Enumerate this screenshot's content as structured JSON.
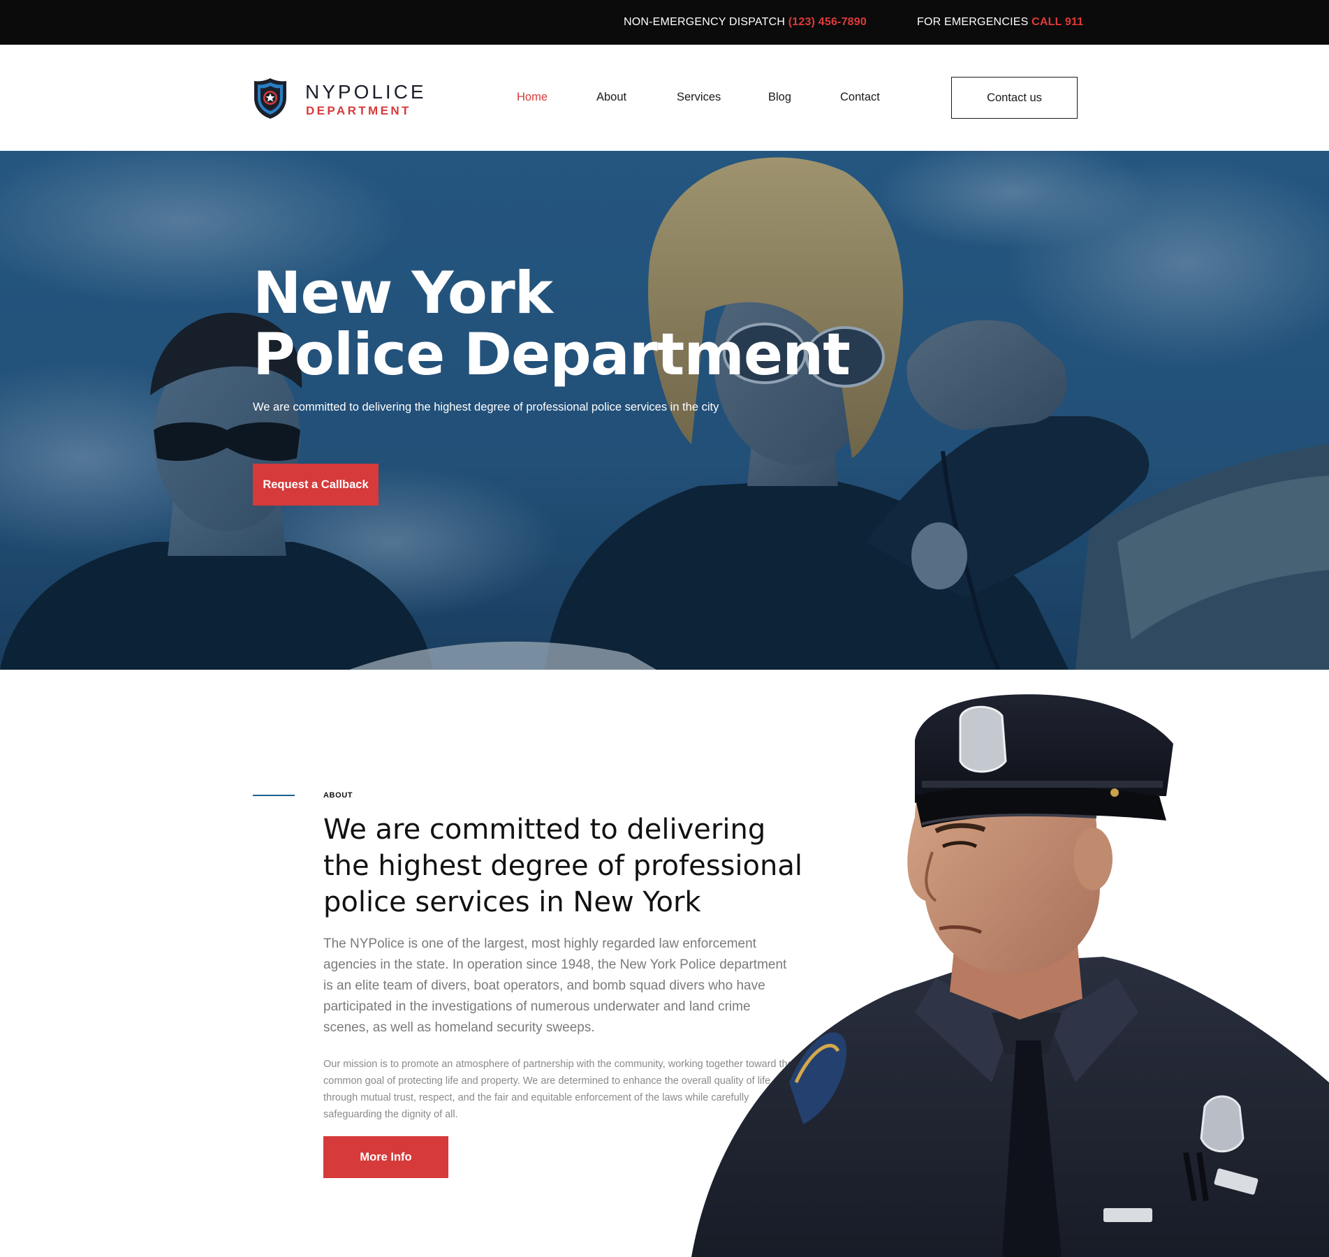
{
  "topbar": {
    "dispatch_label": "NON-EMERGENCY DISPATCH",
    "dispatch_phone": "(123) 456-7890",
    "emergency_label": "FOR EMERGENCIES",
    "emergency_call": "CALL 911"
  },
  "logo": {
    "line1": "NYPOLICE",
    "line2": "DEPARTMENT"
  },
  "nav": {
    "items": [
      {
        "label": "Home",
        "active": true
      },
      {
        "label": "About",
        "active": false
      },
      {
        "label": "Services",
        "active": false
      },
      {
        "label": "Blog",
        "active": false
      },
      {
        "label": "Contact",
        "active": false
      }
    ],
    "cta": "Contact us"
  },
  "hero": {
    "title_line1": "New York",
    "title_line2": "Police Department",
    "subtitle": "We are committed to delivering the highest degree of professional police services in the city",
    "button": "Request a Callback"
  },
  "about": {
    "eyebrow": "ABOUT",
    "heading": "We are committed to delivering the highest degree of professional police services in New York",
    "lead": "The NYPolice  is one of the largest, most highly regarded law enforcement agencies in the state. In operation since 1948, the New York Police department  is an elite team of divers, boat operators, and bomb squad divers who have participated in the investigations of numerous underwater and land crime scenes, as well as homeland security sweeps.",
    "body": "Our mission is to promote an atmosphere of partnership with the community, working together toward the common goal of protecting life and property. We are determined to enhance the overall quality of life through mutual trust, respect, and the fair and equitable enforcement of the laws while carefully safeguarding the dignity of all.",
    "button": "More Info"
  },
  "colors": {
    "accent_red": "#d63a3a",
    "topbar_bg": "#0b0b0b",
    "hero_blue": "#26557d",
    "navy": "#1b1f2a"
  },
  "icons": {
    "logo": "police-shield-star-icon"
  }
}
